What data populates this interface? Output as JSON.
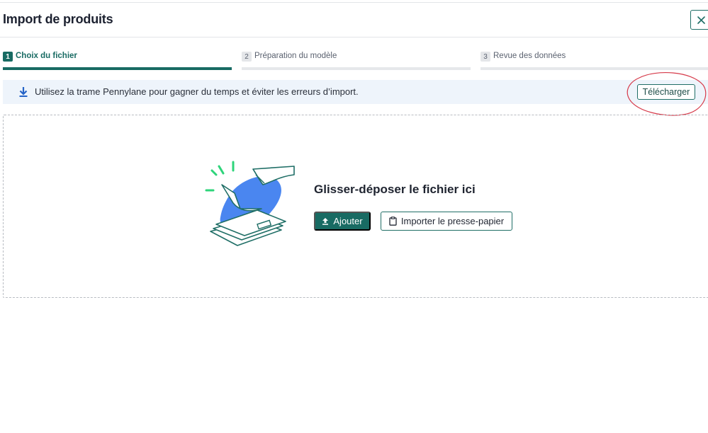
{
  "header": {
    "title": "Import de produits"
  },
  "steps": [
    {
      "num": "1",
      "label": "Choix du fichier",
      "state": "active"
    },
    {
      "num": "2",
      "label": "Préparation du modèle",
      "state": "inactive"
    },
    {
      "num": "3",
      "label": "Revue des données",
      "state": "inactive"
    }
  ],
  "banner": {
    "message": "Utilisez la trame Pennylane pour gagner du temps et éviter les erreurs d’import.",
    "download_label": "Télécharger"
  },
  "dropzone": {
    "title": "Glisser-déposer le fichier ici",
    "add_label": "Ajouter",
    "paste_label": "Importer le presse-papier"
  },
  "colors": {
    "accent": "#186b63",
    "banner_bg": "#eef4fb",
    "annotation": "#d63a4a",
    "illustration_blue": "#4a86f0",
    "illustration_green": "#2ed47a"
  }
}
